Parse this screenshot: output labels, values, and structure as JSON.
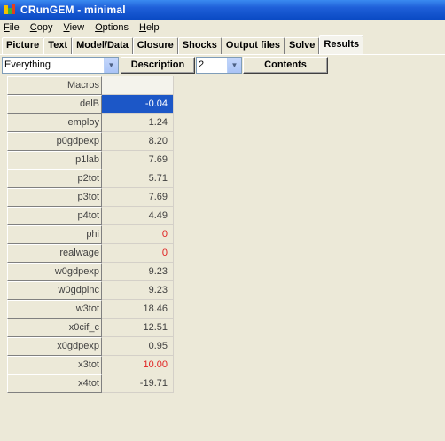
{
  "window": {
    "title": "CRunGEM - minimal"
  },
  "menu": [
    {
      "label": "File",
      "u": "F",
      "rest": "ile"
    },
    {
      "label": "Copy",
      "u": "C",
      "rest": "opy"
    },
    {
      "label": "View",
      "u": "V",
      "rest": "iew"
    },
    {
      "label": "Options",
      "u": "O",
      "rest": "ptions"
    },
    {
      "label": "Help",
      "u": "H",
      "rest": "elp"
    }
  ],
  "tabs": [
    "Picture",
    "Text",
    "Model/Data",
    "Closure",
    "Shocks",
    "Output files",
    "Solve",
    "Results"
  ],
  "active_tab": "Results",
  "toolbar": {
    "filter_value": "Everything",
    "description_label": "Description",
    "page_value": "2",
    "contents_label": "Contents"
  },
  "grid": {
    "header": "Macros",
    "rows": [
      {
        "name": "delB",
        "value": "-0.04",
        "style": "sel"
      },
      {
        "name": "employ",
        "value": "1.24"
      },
      {
        "name": "p0gdpexp",
        "value": "8.20"
      },
      {
        "name": "p1lab",
        "value": "7.69"
      },
      {
        "name": "p2tot",
        "value": "5.71"
      },
      {
        "name": "p3tot",
        "value": "7.69"
      },
      {
        "name": "p4tot",
        "value": "4.49"
      },
      {
        "name": "phi",
        "value": "0",
        "style": "red"
      },
      {
        "name": "realwage",
        "value": "0",
        "style": "red"
      },
      {
        "name": "w0gdpexp",
        "value": "9.23"
      },
      {
        "name": "w0gdpinc",
        "value": "9.23"
      },
      {
        "name": "w3tot",
        "value": "18.46"
      },
      {
        "name": "x0cif_c",
        "value": "12.51"
      },
      {
        "name": "x0gdpexp",
        "value": "0.95"
      },
      {
        "name": "x3tot",
        "value": "10.00",
        "style": "red"
      },
      {
        "name": "x4tot",
        "value": "-19.71"
      }
    ]
  },
  "colors": {
    "title_bar": "#0a4ac4",
    "selection": "#1c57c7",
    "exogenous_red": "#e02020"
  }
}
